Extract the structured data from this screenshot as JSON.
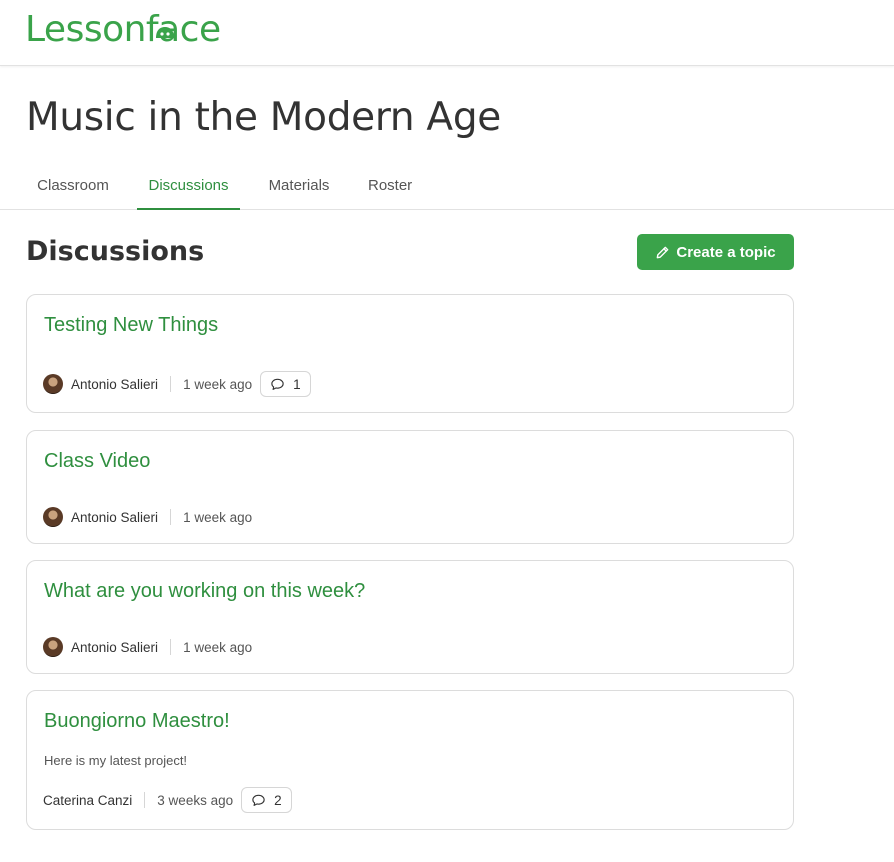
{
  "header": {
    "logo_text": "Lessonface"
  },
  "course": {
    "title": "Music in the Modern Age"
  },
  "tabs": [
    {
      "label": "Classroom"
    },
    {
      "label": "Discussions",
      "active": true
    },
    {
      "label": "Materials"
    },
    {
      "label": "Roster"
    }
  ],
  "discussions": {
    "heading": "Discussions",
    "create_label": "Create a topic",
    "topics": [
      {
        "title": "Testing New Things",
        "author": "Antonio Salieri",
        "time": "1 week ago",
        "comments": "1"
      },
      {
        "title": "Class Video",
        "author": "Antonio Salieri",
        "time": "1 week ago"
      },
      {
        "title": "What are you working on this week?",
        "author": "Antonio Salieri",
        "time": "1 week ago"
      },
      {
        "title": "Buongiorno Maestro!",
        "excerpt": "Here is my latest project!",
        "author": "Caterina Canzi",
        "time": "3 weeks ago",
        "comments": "2"
      }
    ]
  },
  "colors": {
    "brand": "#3aa34a",
    "link": "#2f8f3f",
    "text": "#333333",
    "border": "#dcdcdc"
  },
  "icons": {
    "create": "pencil-icon",
    "comments": "speech-bubble-icon"
  }
}
